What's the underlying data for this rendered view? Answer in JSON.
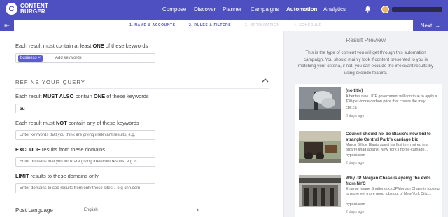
{
  "brand": {
    "name": "CONTENT BURGER",
    "logo_letter": "C",
    "accent": "#4e4fc0"
  },
  "nav": {
    "items": [
      "Compose",
      "Discover",
      "Planner",
      "Campaigns",
      "Automation",
      "Analytics"
    ],
    "active": "Automation"
  },
  "stepper": {
    "steps": [
      "1. NAME & ACCOUNTS",
      "2. RULES & FILTERS",
      "3. OPTIMIZATION",
      "4. SCHEDULE"
    ],
    "back_label": "⇤",
    "next_label": "Next",
    "next_icon": "→"
  },
  "form": {
    "must_contain_label_pre": "Each result must contain at least ",
    "must_contain_label_bold": "ONE",
    "must_contain_label_post": " of these keywords",
    "keyword_chip": "business",
    "keyword_chip_remove": "×",
    "keyword_placeholder": "Add keywords",
    "refine_title": "REFINE YOUR QUERY",
    "must_also_pre": "Each result ",
    "must_also_bold": "MUST ALSO",
    "must_also_mid": " contain ",
    "must_also_bold2": "ONE",
    "must_also_post": " of these keywords",
    "must_also_value": "au",
    "must_not_pre": "Each result must ",
    "must_not_bold": "NOT",
    "must_not_post": " contain any of these keywords",
    "must_not_placeholder": "Enter keywords that you think are giving irrelevant results, e.g.)",
    "exclude_bold": "EXCLUDE",
    "exclude_post": " results from these domains",
    "exclude_placeholder": "Enter domains that you think are giving irrelevant results, e.g. c",
    "limit_bold": "LIMIT",
    "limit_post": " results to these domains only",
    "limit_placeholder": "Enter domains to see results from only these sites... e.g cnn.com",
    "post_language_label": "Post Language",
    "post_language_value": "English",
    "post_language_arrow": "⬍"
  },
  "preview": {
    "title": "Result Preview",
    "description": "This is the type of content you will get through this automation campaign. You should mainly look if content presented to you is matching your criteria, if not, you can exclude the irrelevant results by using exclude feature.",
    "cards": [
      {
        "title": "(no title)",
        "desc": "Alberta's new UCP government will continue to apply a $30-per-tonne carbon price that covers the may...",
        "source": "cbc.ca",
        "time": "2 days ago"
      },
      {
        "title": "Council should nix de Blasio's new bid to strangle Central Park's carriage biz",
        "desc": "Mayor Bill de Blasio spent his first term mired in a bizarre jihad against New York's horse-carriage...",
        "source": "nypost.com",
        "time": "2 days ago"
      },
      {
        "title": "Why JP Morgan Chase is eyeing the exits from NYC",
        "desc": "Enlarge Image Shutterstock JPMorgan Chase is looking to move yet more good jobs out of New York City,...",
        "source": "nypost.com",
        "time": "2 days ago"
      }
    ]
  }
}
